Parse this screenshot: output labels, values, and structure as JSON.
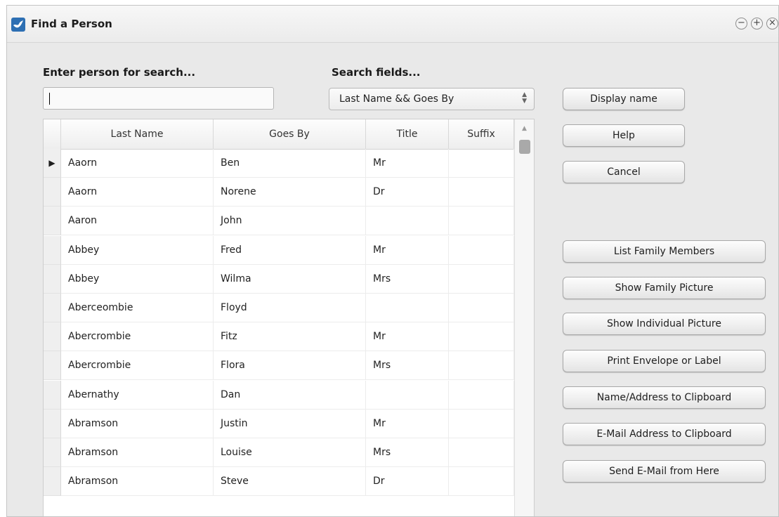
{
  "window": {
    "title": "Find a Person",
    "controls": [
      "minimize-icon",
      "maximize-icon",
      "close-icon"
    ]
  },
  "search": {
    "label": "Enter person for search...",
    "value": "",
    "placeholder": ""
  },
  "fields": {
    "label": "Search fields...",
    "selected": "Last Name && Goes By"
  },
  "table": {
    "columns": [
      "Last Name",
      "Goes By",
      "Title",
      "Suffix"
    ],
    "rows": [
      [
        "Aaorn",
        "Ben",
        "Mr",
        ""
      ],
      [
        "Aaorn",
        "Norene",
        "Dr",
        ""
      ],
      [
        "Aaron",
        "John",
        "",
        ""
      ],
      [
        "Abbey",
        "Fred",
        "Mr",
        ""
      ],
      [
        "Abbey",
        "Wilma",
        "Mrs",
        ""
      ],
      [
        "Aberceombie",
        "Floyd",
        "",
        ""
      ],
      [
        "Abercrombie",
        "Fitz",
        "Mr",
        ""
      ],
      [
        "Abercrombie",
        "Flora",
        "Mrs",
        ""
      ],
      [
        "Abernathy",
        "Dan",
        "",
        ""
      ],
      [
        "Abramson",
        "Justin",
        "Mr",
        ""
      ],
      [
        "Abramson",
        "Louise",
        "Mrs",
        ""
      ],
      [
        "Abramson",
        "Steve",
        "Dr",
        ""
      ]
    ],
    "selected_row": 0,
    "row_indicator": "▶"
  },
  "buttons": {
    "display_name": "Display name",
    "help": "Help",
    "cancel": "Cancel",
    "list_family": "List Family Members",
    "family_picture": "Show Family Picture",
    "individual_picture": "Show Individual Picture",
    "print_envelope": "Print Envelope or Label",
    "name_clipboard": "Name/Address to Clipboard",
    "email_clipboard": "E-Mail Address to Clipboard",
    "send_email": "Send E-Mail from Here"
  },
  "colors": {
    "window_bg": "#e9e9e9",
    "accent": "#2d6fb3"
  }
}
